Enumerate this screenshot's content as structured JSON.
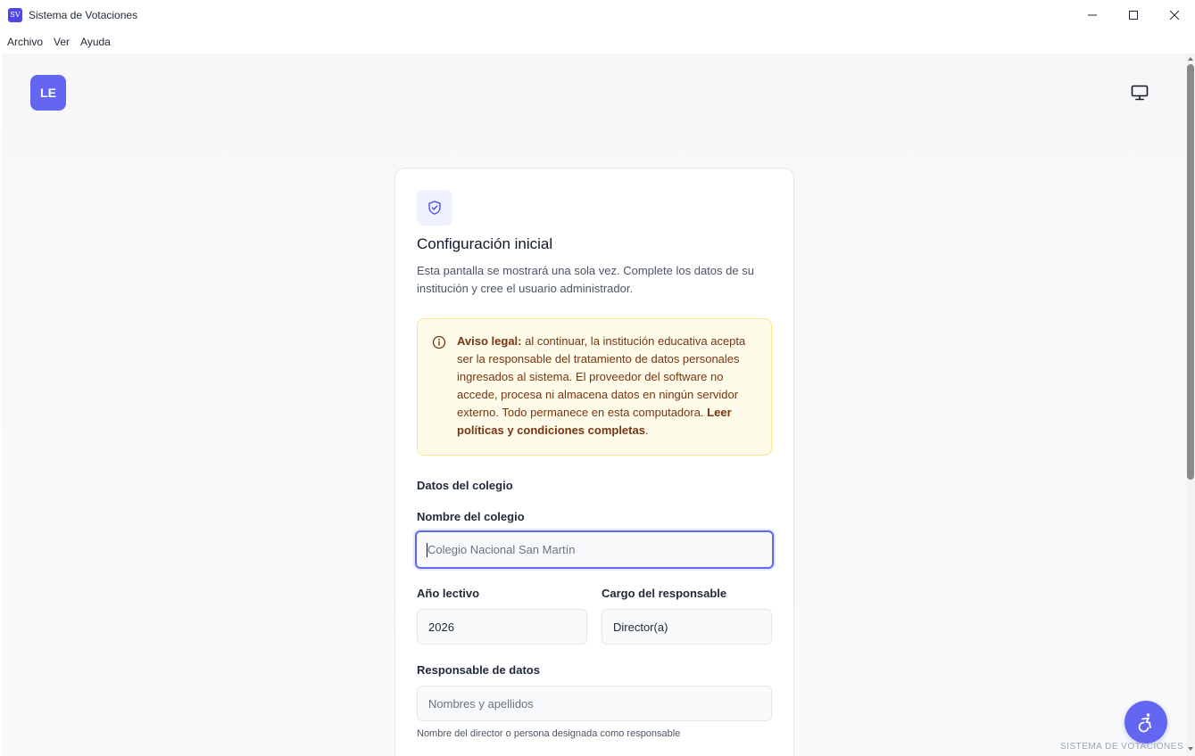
{
  "window": {
    "app_icon_text": "SV",
    "title": "Sistema de Votaciones"
  },
  "menu": {
    "items": [
      "Archivo",
      "Ver",
      "Ayuda"
    ]
  },
  "header": {
    "logo_initials": "LE",
    "logo_color": "#6366f1",
    "display_toggle_icon": "monitor-icon"
  },
  "setup": {
    "icon": "shield-check-icon",
    "title": "Configuración inicial",
    "description": "Esta pantalla se mostrará una sola vez. Complete los datos de su institución y cree el usuario administrador.",
    "notice": {
      "icon": "info-icon",
      "label": "Aviso legal:",
      "body": " al continuar, la institución educativa acepta ser la responsable del tratamiento de datos personales ingresados al sistema. El proveedor del software no accede, procesa ni almacena datos en ningún servidor externo. Todo permanece en esta computadora. ",
      "link": "Leer políticas y condiciones completas",
      "end": "."
    },
    "section_title": "Datos del colegio",
    "school_name": {
      "label": "Nombre del colegio",
      "placeholder": "Colegio Nacional San Martín",
      "value": ""
    },
    "school_year": {
      "label": "Año lectivo",
      "value": "2026"
    },
    "role": {
      "label": "Cargo del responsable",
      "value": "Director(a)"
    },
    "data_manager": {
      "label": "Responsable de datos",
      "placeholder": "Nombres y apellidos",
      "helper": "Nombre del director o persona designada como responsable"
    }
  },
  "accessibility": {
    "icon": "accessibility-icon"
  },
  "footer": {
    "brand": "SISTEMA DE VOTACIONES"
  },
  "colors": {
    "accent": "#6366f1",
    "notice_bg": "#fffbeb",
    "notice_border": "#fde68a",
    "notice_text": "#78350f"
  }
}
